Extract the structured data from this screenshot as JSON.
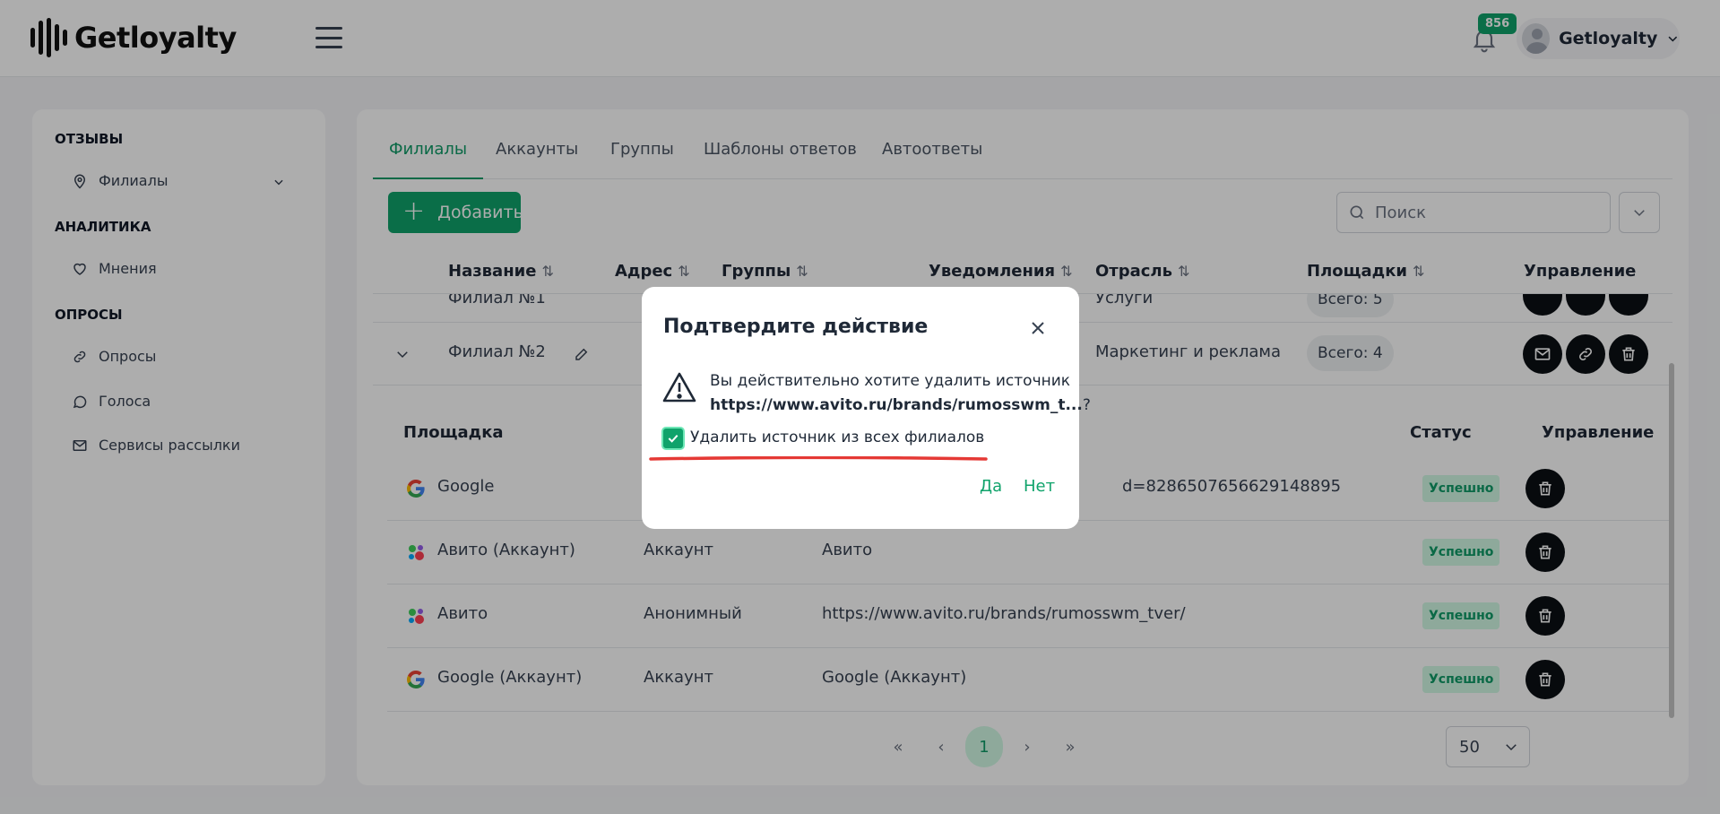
{
  "header": {
    "logo_text": "Getloyalty",
    "notification_count": "856",
    "user_name": "Getloyalty"
  },
  "sidebar": {
    "sections": [
      {
        "title": "ОТЗЫВЫ",
        "items": [
          {
            "label": "Филиалы",
            "icon": "map-pin-icon"
          }
        ]
      },
      {
        "title": "АНАЛИТИКА",
        "items": [
          {
            "label": "Мнения",
            "icon": "heart-icon"
          }
        ]
      },
      {
        "title": "ОПРОСЫ",
        "items": [
          {
            "label": "Опросы",
            "icon": "link-icon"
          },
          {
            "label": "Голоса",
            "icon": "chat-icon"
          },
          {
            "label": "Сервисы рассылки",
            "icon": "mail-icon"
          }
        ]
      }
    ]
  },
  "tabs": [
    "Филиалы",
    "Аккаунты",
    "Группы",
    "Шаблоны ответов",
    "Автоответы"
  ],
  "toolbar": {
    "add_label": "Добавить",
    "search_placeholder": "Поиск"
  },
  "table": {
    "columns": [
      "Название",
      "Адрес",
      "Группы",
      "Уведомления",
      "Отрасль",
      "Площадки",
      "Управление"
    ],
    "rows": [
      {
        "name": "Филиал №1",
        "industry": "Услуги",
        "platforms": "Всего: 5"
      },
      {
        "name": "Филиал №2",
        "industry": "Маркетинг и реклама",
        "platforms": "Всего: 4"
      }
    ]
  },
  "sources": {
    "columns": [
      "Площадка",
      "Статус",
      "Управление"
    ],
    "rows": [
      {
        "platform": "Google",
        "type": "",
        "link": "d=8286507656629148895",
        "status": "Успешно",
        "icon": "google-icon"
      },
      {
        "platform": "Авито (Аккаунт)",
        "type": "Аккаунт",
        "link": "Авито",
        "status": "Успешно",
        "icon": "avito-icon"
      },
      {
        "platform": "Авито",
        "type": "Анонимный",
        "link": "https://www.avito.ru/brands/rumosswm_tver/",
        "status": "Успешно",
        "icon": "avito-icon"
      },
      {
        "platform": "Google (Аккаунт)",
        "type": "Аккаунт",
        "link": "Google (Аккаунт)",
        "status": "Успешно",
        "icon": "google-icon"
      }
    ]
  },
  "pagination": {
    "first": "«",
    "prev": "‹",
    "current": "1",
    "next": "›",
    "last": "»",
    "per_page": "50"
  },
  "modal": {
    "title": "Подтвердите действие",
    "message": "Вы действительно хотите удалить источник",
    "url": "https://www.avito.ru/brands/rumosswm_t...",
    "url_suffix": "?",
    "checkbox_label": "Удалить источник из всех филиалов",
    "checkbox_checked": true,
    "yes": "Да",
    "no": "Нет"
  },
  "colors": {
    "accent": "#10a36b",
    "status_bg": "#d1fae5",
    "annotation_underline": "#e53935"
  }
}
